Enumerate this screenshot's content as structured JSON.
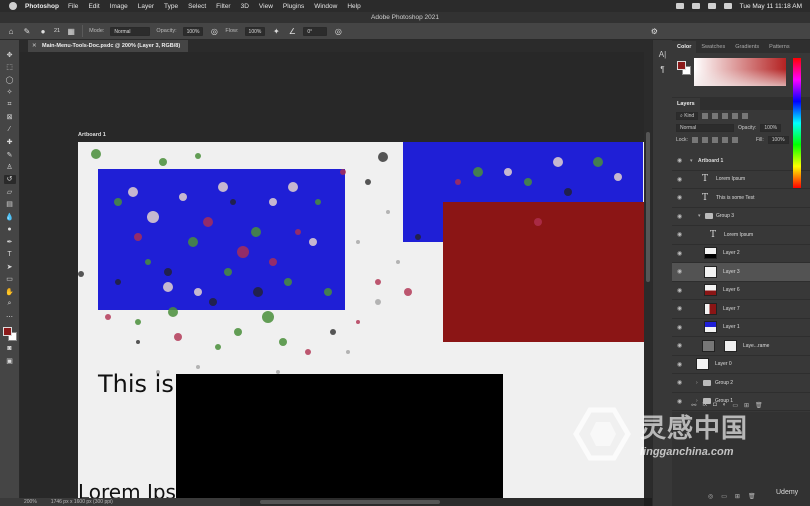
{
  "menubar": {
    "app_name": "Photoshop",
    "items": [
      "File",
      "Edit",
      "Image",
      "Layer",
      "Type",
      "Select",
      "Filter",
      "3D",
      "View",
      "Plugins",
      "Window",
      "Help"
    ],
    "clock": "Tue May 11  11:18 AM"
  },
  "titlebar": {
    "title": "Adobe Photoshop 2021"
  },
  "options": {
    "brush_size": "21",
    "mode_label": "Mode:",
    "mode_value": "Normal",
    "opacity_label": "Opacity:",
    "opacity_value": "100%",
    "flow_label": "Flow:",
    "flow_value": "100%",
    "angle_value": "0°"
  },
  "document": {
    "tab_title": "Main-Menu-Tools-Doc.psdc @ 200% (Layer 3, RGB/8)",
    "artboard_label": "Artboard 1",
    "text_large": "This is so",
    "text_lorem": "Lorem Ips",
    "blue_color": "#1f1fd6",
    "red_color": "#8b1515"
  },
  "statusbar": {
    "zoom": "200%",
    "doc_size": "1746 px x 1600 px (300 ppi)"
  },
  "color_panel": {
    "tabs": [
      "Color",
      "Swatches",
      "Gradients",
      "Patterns"
    ],
    "foreground": "#8b1a1a",
    "background": "#ffffff"
  },
  "layers_panel": {
    "tab": "Layers",
    "kind_label": "Kind",
    "blend_mode": "Normal",
    "opacity_label": "Opacity:",
    "opacity_value": "100%",
    "lock_label": "Lock:",
    "fill_label": "Fill:",
    "fill_value": "100%",
    "layers": [
      {
        "name": "Artboard 1",
        "type": "artboard",
        "indent": 0
      },
      {
        "name": "Lorem Ipsum",
        "type": "text",
        "indent": 1
      },
      {
        "name": "This is some Test",
        "type": "text",
        "indent": 1
      },
      {
        "name": "Group 3",
        "type": "group",
        "indent": 1
      },
      {
        "name": "Lorem Ipsum",
        "type": "text",
        "indent": 2
      },
      {
        "name": "Layer 2",
        "type": "pixel",
        "indent": 1
      },
      {
        "name": "Layer 3",
        "type": "pixel",
        "indent": 1,
        "selected": true
      },
      {
        "name": "Layer 6",
        "type": "pixel",
        "indent": 1
      },
      {
        "name": "Layer 7",
        "type": "pixel",
        "indent": 1
      },
      {
        "name": "Layer 1",
        "type": "pixel",
        "indent": 1
      },
      {
        "name": "Laye...rame",
        "type": "frame",
        "indent": 1
      },
      {
        "name": "Layer 0",
        "type": "pixel",
        "indent": 0
      },
      {
        "name": "Group 2",
        "type": "group",
        "indent": 0
      },
      {
        "name": "Group 1",
        "type": "group",
        "indent": 0
      }
    ]
  },
  "watermark": {
    "cn_text": "灵感中国",
    "url": "lingganchina.com"
  },
  "udemy": "Udemy"
}
